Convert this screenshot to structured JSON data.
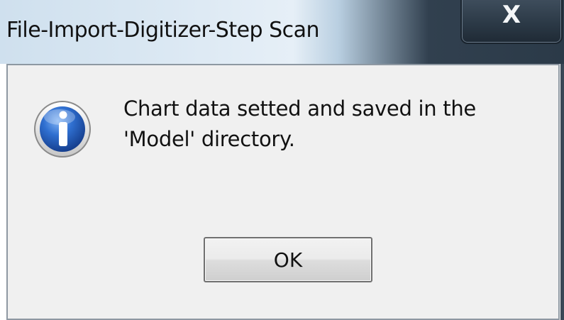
{
  "window": {
    "title": "File-Import-Digitizer-Step Scan",
    "close_label": "X"
  },
  "dialog": {
    "icon": "information-icon",
    "message": "Chart data setted and saved in the\n'Model' directory.",
    "ok_label": "OK"
  },
  "colors": {
    "icon_blue": "#2f6fd0",
    "client_background": "#f0f0f0"
  }
}
